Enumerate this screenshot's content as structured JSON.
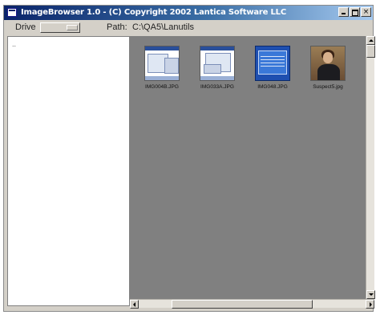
{
  "window": {
    "title": "ImageBrowser 1.0 - (C) Copyright 2002 Lantica Software LLC",
    "controls": {
      "minimize_label": "_",
      "maximize_label": "",
      "close_label": "×"
    }
  },
  "toolbar": {
    "drive_label": "Drive",
    "drive_value": "",
    "path_label": "Path:",
    "path_value": "C:\\QA5\\Lanutils"
  },
  "tree": {
    "items": [
      {
        "label": ".."
      }
    ]
  },
  "thumbnails": [
    {
      "caption": "IMG004B.JPG",
      "kind": "screenshot"
    },
    {
      "caption": "IMG033A.JPG",
      "kind": "screenshot"
    },
    {
      "caption": "IMG048.JPG",
      "kind": "blue-screen"
    },
    {
      "caption": "Suspect5.jpg",
      "kind": "photo"
    }
  ],
  "colors": {
    "titlebar_start": "#0a246a",
    "titlebar_end": "#a6caf0",
    "window_face": "#d4d0c8",
    "thumb_pane": "#808080"
  }
}
